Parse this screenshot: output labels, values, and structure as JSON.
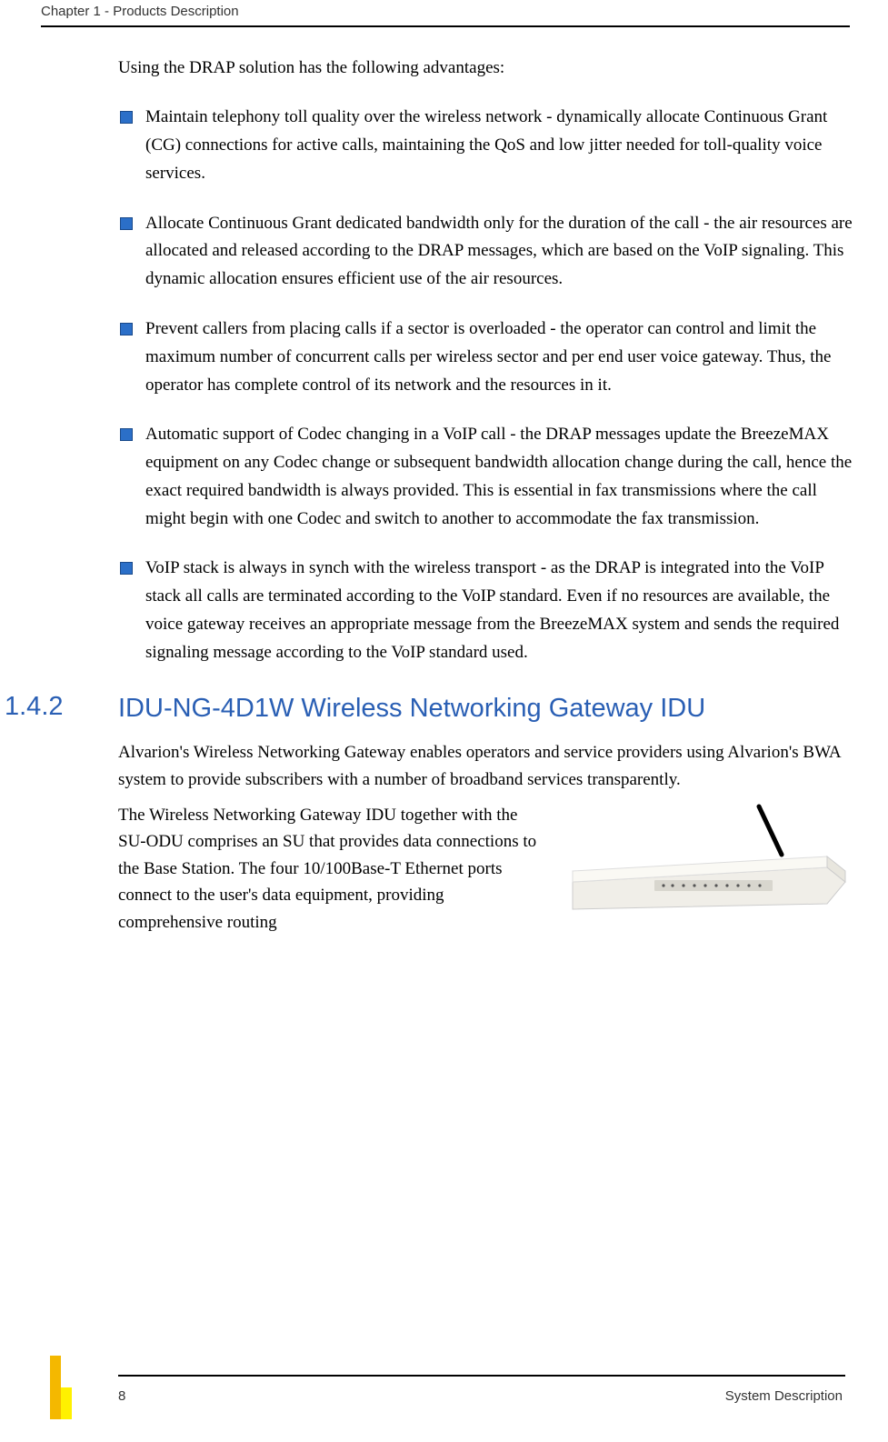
{
  "header": {
    "chapter": "Chapter 1 - Products Description"
  },
  "intro": "Using the DRAP solution has the following advantages:",
  "bullets": [
    "Maintain telephony toll quality over the wireless network - dynamically allocate Continuous Grant (CG) connections for active calls, maintaining the QoS and low jitter needed for toll-quality voice services.",
    "Allocate Continuous Grant dedicated bandwidth only for the duration of the call - the air resources are allocated and released according to the DRAP messages, which are based on the VoIP signaling. This dynamic allocation ensures efficient use of the air resources.",
    "Prevent callers from placing calls if a sector is overloaded - the operator can control and limit the maximum number of concurrent calls per wireless sector and per end user voice gateway. Thus, the operator has complete control of its network and the resources in it.",
    "Automatic support of Codec changing in a VoIP call - the DRAP messages update the BreezeMAX equipment on any Codec change or subsequent bandwidth allocation change during the call, hence the exact required bandwidth is always provided. This is essential in fax transmissions where the call might begin with one Codec and switch to another to accommodate the fax transmission.",
    "VoIP stack is always in synch with the wireless transport - as the DRAP is integrated into the VoIP stack all calls are terminated according to the VoIP standard. Even if no resources are available, the voice gateway receives an appropriate message from the BreezeMAX system and sends the required signaling message according to the VoIP standard used."
  ],
  "section": {
    "number": "1.4.2",
    "title": "IDU-NG-4D1W Wireless Networking Gateway IDU"
  },
  "para1": "Alvarion's Wireless Networking Gateway enables operators and service providers using Alvarion's BWA system to provide subscribers with a number of broadband services transparently.",
  "para2": "The Wireless Networking Gateway IDU together with the SU-ODU comprises an SU that provides data connections to the Base Station. The four 10/100Base-T Ethernet ports connect to the user's data equipment, providing comprehensive routing",
  "footer": {
    "page": "8",
    "label": "System Description"
  }
}
